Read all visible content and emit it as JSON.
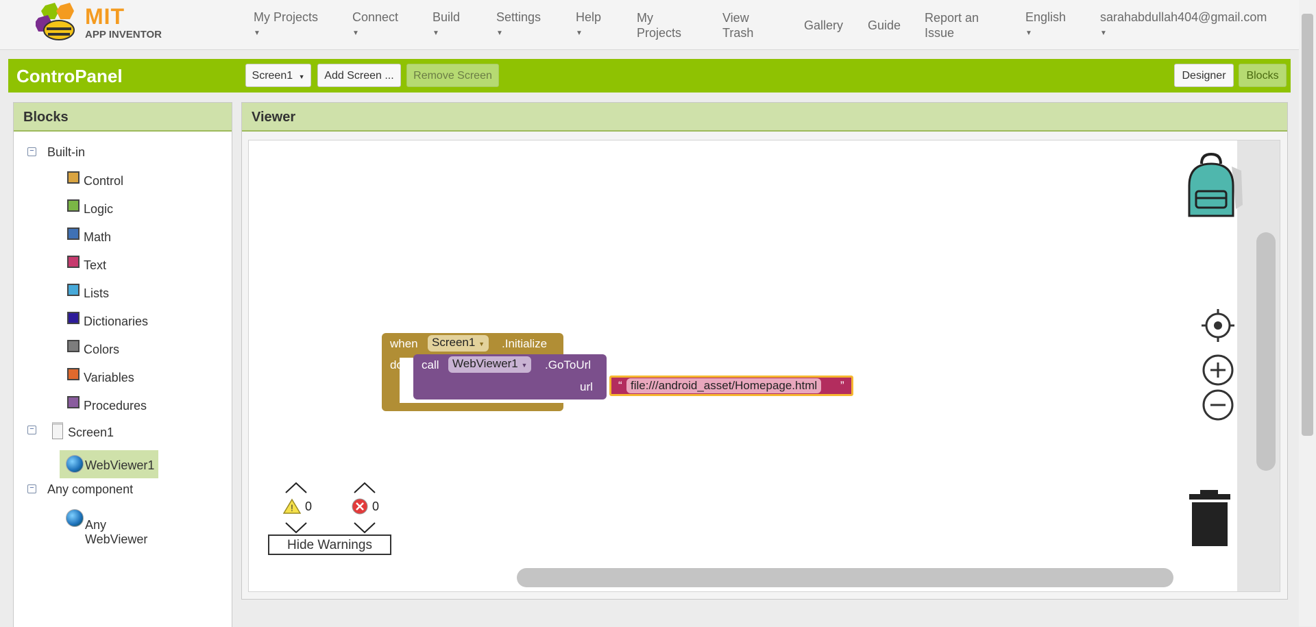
{
  "app": {
    "logo_main": "MIT",
    "logo_sub": "APP INVENTOR"
  },
  "nav": {
    "my_projects_menu": "My Projects",
    "connect": "Connect",
    "build": "Build",
    "settings": "Settings",
    "help": "Help",
    "my_projects_link": "My Projects",
    "view_trash": "View Trash",
    "gallery": "Gallery",
    "guide": "Guide",
    "report_issue": "Report an Issue",
    "language": "English",
    "user": "sarahabdullah404@gmail.com"
  },
  "project": {
    "title": "ControPanel",
    "screen_select": "Screen1",
    "add_screen": "Add Screen ...",
    "remove_screen": "Remove Screen",
    "designer": "Designer",
    "blocks": "Blocks"
  },
  "blocks_panel": {
    "heading": "Blocks",
    "builtin_label": "Built-in",
    "builtin_items": [
      {
        "label": "Control",
        "color": "#d9a441"
      },
      {
        "label": "Logic",
        "color": "#7bb646"
      },
      {
        "label": "Math",
        "color": "#3f71b5"
      },
      {
        "label": "Text",
        "color": "#c63a6e"
      },
      {
        "label": "Lists",
        "color": "#46a9d9"
      },
      {
        "label": "Dictionaries",
        "color": "#2d1b99"
      },
      {
        "label": "Colors",
        "color": "#7d7d7d"
      },
      {
        "label": "Variables",
        "color": "#e0692d"
      },
      {
        "label": "Procedures",
        "color": "#8a5c9e"
      }
    ],
    "screen_label": "Screen1",
    "screen_child": "WebViewer1",
    "any_label": "Any component",
    "any_child": "Any WebViewer"
  },
  "viewer": {
    "heading": "Viewer",
    "event_when": "when",
    "event_component": "Screen1",
    "event_name": ".Initialize",
    "do_label": "do",
    "call_label": "call",
    "call_component": "WebViewer1",
    "call_method": ".GoToUrl",
    "param_label": "url",
    "open_quote": "“",
    "close_quote": "”",
    "string_value": "file:///android_asset/Homepage.html",
    "warning_count": "0",
    "error_count": "0",
    "hide_warnings": "Hide Warnings"
  }
}
